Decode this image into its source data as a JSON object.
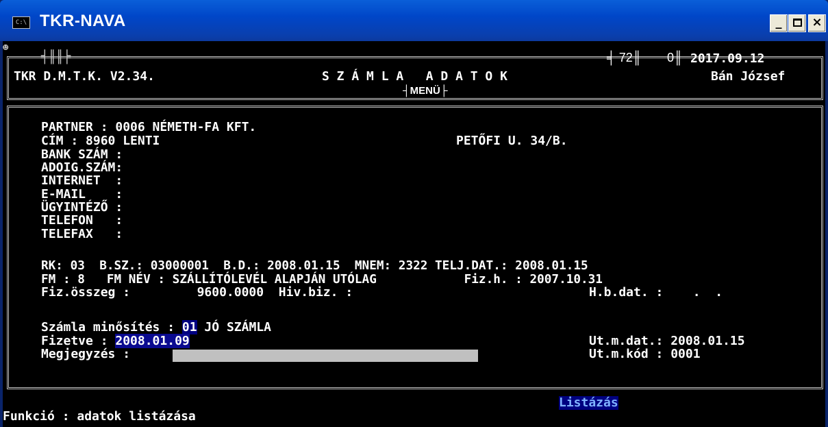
{
  "window": {
    "title": "TKR-NAVA",
    "icon": "console-icon",
    "minimize_label": "_",
    "close_label": "×"
  },
  "header": {
    "app_version": "TKR D.M.T.K. V2.34.",
    "screen_title": "S Z Á M L A   A D A T O K",
    "menu_label": "MENÜ",
    "counter_a": "72",
    "counter_b": "0",
    "date": "2017.09.12",
    "user": "Bán József"
  },
  "partner": {
    "partner_line": "PARTNER : 0006 NÉMETH-FA KFT.",
    "cim_line": "CÍM : 8960 LENTI",
    "address_street": "PETŐFI U. 34/B.",
    "bank_line": "BANK SZÁM :",
    "adoig_line": "ADOIG.SZÁM:",
    "internet_line": "INTERNET  :",
    "email_line": "E-MAIL    :",
    "ugyintezo_line": "ÜGYINTÉZŐ :",
    "telefon_line": "TELEFON   :",
    "telefax_line": "TELEFAX   :"
  },
  "invoice": {
    "row1": "RK: 03  B.SZ.: 03000001  B.D.: 2008.01.15  MNEM: 2322 TELJ.DAT.: 2008.01.15",
    "row2": "FM : 8   FM NÉV : SZÁLLÍTÓLEVÉL ALAPJÁN UTÓLAG            Fiz.h. : 2007.10.31",
    "row3_left": "Fiz.összeg :         9600.0000  Hiv.biz. :",
    "row3_right": "H.b.dat. :    .  ."
  },
  "status": {
    "minosites_label": "Számla minősítés : ",
    "minosites_code": "01",
    "minosites_text": " JÓ SZÁMLA",
    "fizetve_label": "Fizetve : ",
    "fizetve_value": "2008.01.09",
    "megjegyzes_label": "Megjegyzés : ",
    "megjegyzes_value": "",
    "utm_dat": "Ut.m.dat.: 2008.01.15",
    "utm_kod": "Ut.m.kód : 0001"
  },
  "footer": {
    "listazas_label": "Listázás",
    "funkcio_line": "Funkció : adatok listázása"
  },
  "colors": {
    "background": "#000000",
    "text": "#c0c0c0",
    "highlight": "#000080",
    "titlebar": "#0046c8"
  }
}
